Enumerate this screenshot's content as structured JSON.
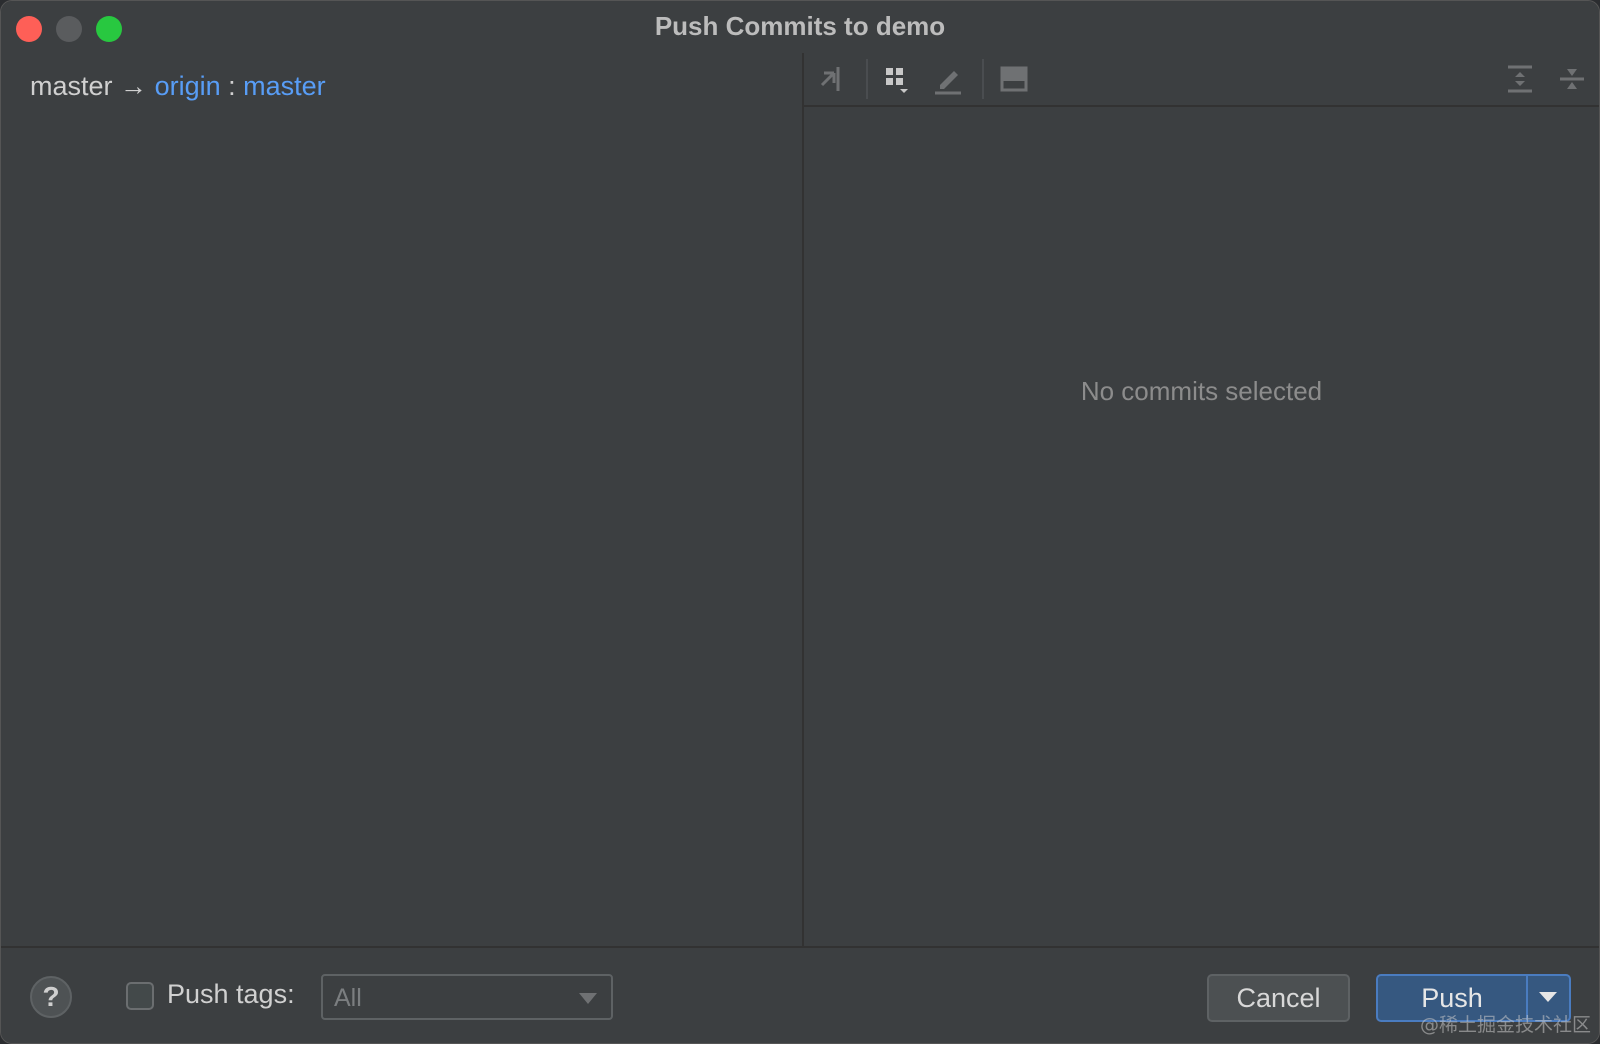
{
  "window": {
    "title": "Push Commits to demo"
  },
  "left_pane": {
    "local_branch": "master",
    "arrow": "→",
    "remote": "origin",
    "separator": ":",
    "remote_branch": "master"
  },
  "right_pane": {
    "toolbar": {
      "icons": [
        "cherry-pick-icon",
        "group-by-icon",
        "edit-icon",
        "preview-icon",
        "expand-all-icon",
        "collapse-all-icon"
      ]
    },
    "empty_message": "No commits selected"
  },
  "footer": {
    "help_label": "?",
    "push_tags_label": "Push tags:",
    "push_tags_checked": false,
    "tags_select_value": "All",
    "cancel_label": "Cancel",
    "push_label": "Push"
  },
  "watermark": "@稀土掘金技术社区",
  "colors": {
    "link": "#589df6",
    "primary_button": "#365880",
    "close": "#fe5f57",
    "maximize": "#28c840"
  }
}
